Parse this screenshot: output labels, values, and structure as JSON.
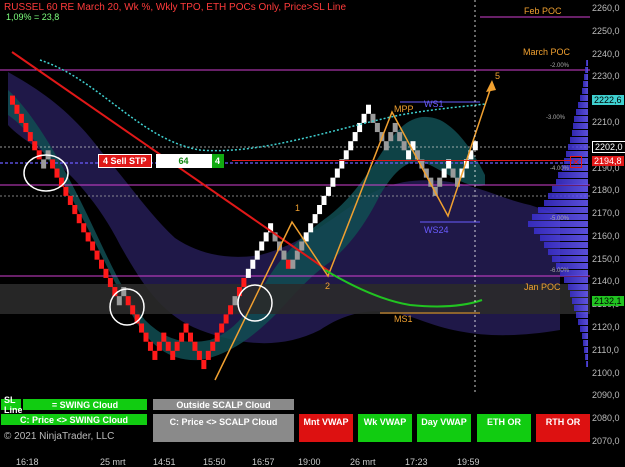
{
  "header": {
    "title": "RUSSEL 60 RE March 20, Wk %, Wkly TPO, ETH POCs Only, Price>SL Line",
    "subtitle": "1,09% = 23,8"
  },
  "price_axis": [
    "2260,0",
    "2250,0",
    "2240,0",
    "2230,0",
    "2220,0",
    "2210,0",
    "2200,0",
    "2190,0",
    "2180,0",
    "2170,0",
    "2160,0",
    "2150,0",
    "2140,0",
    "2130,0",
    "2120,0",
    "2110,0",
    "2100,0",
    "2090,0",
    "2080,0",
    "2070,0"
  ],
  "price_tags": {
    "t1": {
      "text": "2222,6",
      "color": "#3fd0d0"
    },
    "t2": {
      "text": "2202,0",
      "color": "#ffffff"
    },
    "t3": {
      "text": "2194,8",
      "color": "#ff2a2a"
    },
    "t4": {
      "text": "2132,1",
      "color": "#21c421"
    }
  },
  "time_axis": [
    "16:18",
    "25 mrt",
    "14:51",
    "15:50",
    "16:57",
    "19:00",
    "26 mrt",
    "17:23",
    "19:59"
  ],
  "chart_labels": {
    "feb_poc": "Feb POC",
    "march_poc": "March POC",
    "jan_poc": "Jan POC",
    "mpp": "MPP",
    "ws1": "WS1",
    "ws24": "WS24",
    "ms1": "MS1",
    "wave1": "1",
    "wave2": "2",
    "wave5": "5"
  },
  "pct_labels": [
    "-2.00%",
    "-3.00%",
    "-4.00%",
    "-5.00%",
    "-6.00%"
  ],
  "order": {
    "label": "4 Sell STP",
    "qty": "64",
    "count": "4"
  },
  "buttons": {
    "sl_line": "SL Line",
    "swing_cloud": "= SWING Cloud",
    "price_swing": "C: Price <> SWING Cloud",
    "outside_scalp": "Outside SCALP Cloud",
    "price_scalp": "C: Price <> SCALP Cloud",
    "mnt_vwap": "Mnt VWAP",
    "wk_vwap": "Wk VWAP",
    "day_vwap": "Day VWAP",
    "eth_or": "ETH OR",
    "rth_or": "RTH OR"
  },
  "copyright": "© 2021 NinjaTrader, LLC",
  "colors": {
    "bull": "#ffffff",
    "bear": "#ff1a1a",
    "neutral": "#9a9a9a",
    "green_btn": "#11cc11",
    "red_btn": "#dd1111",
    "gray_btn": "#8a8a8a"
  },
  "chart_data": {
    "type": "renko",
    "ylim": [
      2065,
      2265
    ],
    "x_ticks": [
      "16:18",
      "25 mrt",
      "14:51",
      "15:50",
      "16:57",
      "19:00",
      "26 mrt",
      "17:23",
      "19:59"
    ],
    "bricks": [
      [
        2218,
        "bear"
      ],
      [
        2214,
        "bear"
      ],
      [
        2210,
        "bear"
      ],
      [
        2206,
        "bear"
      ],
      [
        2202,
        "bear"
      ],
      [
        2198,
        "bear"
      ],
      [
        2194,
        "bear"
      ],
      [
        2190,
        "neutral"
      ],
      [
        2194,
        "neutral"
      ],
      [
        2190,
        "bear"
      ],
      [
        2186,
        "bear"
      ],
      [
        2182,
        "bear"
      ],
      [
        2178,
        "bear"
      ],
      [
        2174,
        "bear"
      ],
      [
        2170,
        "bear"
      ],
      [
        2166,
        "bear"
      ],
      [
        2162,
        "bear"
      ],
      [
        2158,
        "bear"
      ],
      [
        2154,
        "bear"
      ],
      [
        2150,
        "bear"
      ],
      [
        2146,
        "bear"
      ],
      [
        2142,
        "bear"
      ],
      [
        2138,
        "bear"
      ],
      [
        2134,
        "bear"
      ],
      [
        2130,
        "neutral"
      ],
      [
        2134,
        "neutral"
      ],
      [
        2130,
        "bear"
      ],
      [
        2126,
        "bear"
      ],
      [
        2122,
        "bear"
      ],
      [
        2118,
        "bear"
      ],
      [
        2114,
        "bear"
      ],
      [
        2110,
        "bear"
      ],
      [
        2106,
        "bear"
      ],
      [
        2110,
        "bear"
      ],
      [
        2114,
        "bear"
      ],
      [
        2110,
        "bear"
      ],
      [
        2106,
        "bear"
      ],
      [
        2110,
        "bear"
      ],
      [
        2114,
        "bear"
      ],
      [
        2118,
        "bear"
      ],
      [
        2114,
        "bear"
      ],
      [
        2110,
        "bear"
      ],
      [
        2106,
        "bear"
      ],
      [
        2102,
        "bear"
      ],
      [
        2106,
        "bear"
      ],
      [
        2110,
        "bear"
      ],
      [
        2114,
        "bear"
      ],
      [
        2118,
        "bear"
      ],
      [
        2122,
        "bear"
      ],
      [
        2126,
        "bear"
      ],
      [
        2130,
        "neutral"
      ],
      [
        2134,
        "bear"
      ],
      [
        2138,
        "bear"
      ],
      [
        2142,
        "bull"
      ],
      [
        2146,
        "bull"
      ],
      [
        2150,
        "bull"
      ],
      [
        2154,
        "bull"
      ],
      [
        2158,
        "bull"
      ],
      [
        2162,
        "bull"
      ],
      [
        2158,
        "neutral"
      ],
      [
        2154,
        "neutral"
      ],
      [
        2150,
        "neutral"
      ],
      [
        2146,
        "bear"
      ],
      [
        2146,
        "neutral"
      ],
      [
        2150,
        "neutral"
      ],
      [
        2154,
        "neutral"
      ],
      [
        2158,
        "bull"
      ],
      [
        2162,
        "bull"
      ],
      [
        2166,
        "bull"
      ],
      [
        2170,
        "bull"
      ],
      [
        2174,
        "bull"
      ],
      [
        2178,
        "bull"
      ],
      [
        2182,
        "bull"
      ],
      [
        2186,
        "bull"
      ],
      [
        2190,
        "bull"
      ],
      [
        2194,
        "bull"
      ],
      [
        2198,
        "bull"
      ],
      [
        2202,
        "bull"
      ],
      [
        2206,
        "bull"
      ],
      [
        2210,
        "bull"
      ],
      [
        2214,
        "bull"
      ],
      [
        2210,
        "neutral"
      ],
      [
        2206,
        "neutral"
      ],
      [
        2202,
        "neutral"
      ],
      [
        2198,
        "neutral"
      ],
      [
        2202,
        "neutral"
      ],
      [
        2206,
        "neutral"
      ],
      [
        2202,
        "neutral"
      ],
      [
        2198,
        "neutral"
      ],
      [
        2194,
        "bull"
      ],
      [
        2198,
        "bull"
      ],
      [
        2194,
        "neutral"
      ],
      [
        2190,
        "neutral"
      ],
      [
        2186,
        "neutral"
      ],
      [
        2182,
        "neutral"
      ],
      [
        2178,
        "neutral"
      ],
      [
        2182,
        "neutral"
      ],
      [
        2186,
        "bull"
      ],
      [
        2190,
        "bull"
      ],
      [
        2186,
        "neutral"
      ],
      [
        2182,
        "neutral"
      ],
      [
        2186,
        "bull"
      ],
      [
        2190,
        "bull"
      ],
      [
        2194,
        "bull"
      ],
      [
        2198,
        "bull"
      ]
    ]
  }
}
